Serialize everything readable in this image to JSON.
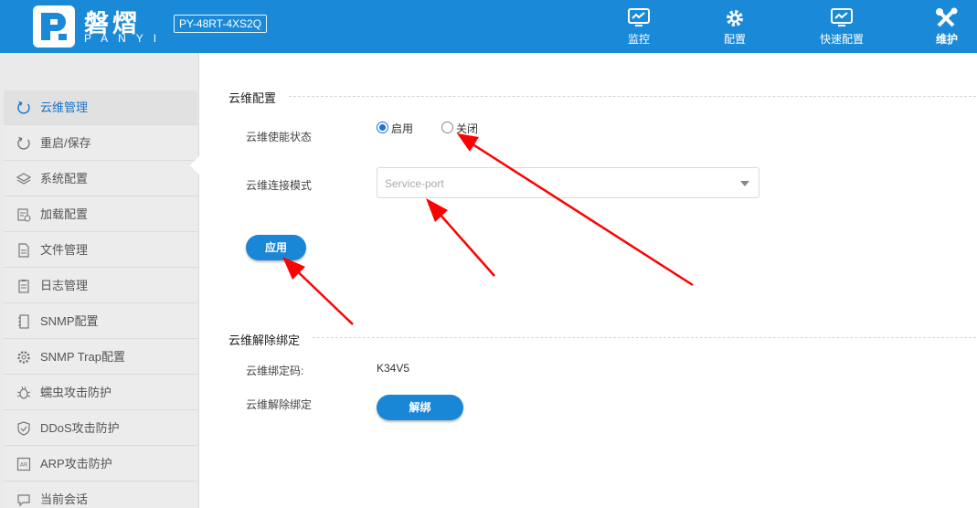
{
  "header": {
    "brand_cn": "磐熠",
    "brand_en": "PANYI",
    "model": "PY-48RT-4XS2Q",
    "nav": [
      {
        "label": "监控",
        "icon": "monitor-icon"
      },
      {
        "label": "配置",
        "icon": "gear-icon"
      },
      {
        "label": "快速配置",
        "icon": "quick-config-icon"
      },
      {
        "label": "维护",
        "icon": "tools-icon",
        "active": true
      }
    ]
  },
  "sidebar": {
    "items": [
      {
        "label": "云维管理",
        "icon": "refresh-icon",
        "active": true
      },
      {
        "label": "重启/保存",
        "icon": "restart-icon"
      },
      {
        "label": "系统配置",
        "icon": "layers-icon"
      },
      {
        "label": "加载配置",
        "icon": "load-config-icon"
      },
      {
        "label": "文件管理",
        "icon": "file-icon"
      },
      {
        "label": "日志管理",
        "icon": "log-icon"
      },
      {
        "label": "SNMP配置",
        "icon": "snmp-icon"
      },
      {
        "label": "SNMP Trap配置",
        "icon": "settings-icon"
      },
      {
        "label": "蠕虫攻击防护",
        "icon": "bug-icon"
      },
      {
        "label": "DDoS攻击防护",
        "icon": "shield-icon"
      },
      {
        "label": "ARP攻击防护",
        "icon": "arp-icon"
      },
      {
        "label": "当前会话",
        "icon": "session-icon"
      }
    ]
  },
  "cloud_config": {
    "title": "云维配置",
    "enable_label": "云维使能状态",
    "radio_on": "启用",
    "radio_off": "关闭",
    "enabled": true,
    "mode_label": "云维连接模式",
    "mode_value": "Service-port",
    "apply_label": "应用"
  },
  "unbind": {
    "title": "云维解除绑定",
    "code_label": "云维绑定码:",
    "code_value": "K34V5",
    "unbind_label": "云维解除绑定",
    "unbind_button": "解绑"
  },
  "colors": {
    "header_bg": "#1a8ad8",
    "button_bg": "#1a86d6",
    "active_text": "#1a73c8",
    "annotation_arrow": "#ff0000"
  }
}
